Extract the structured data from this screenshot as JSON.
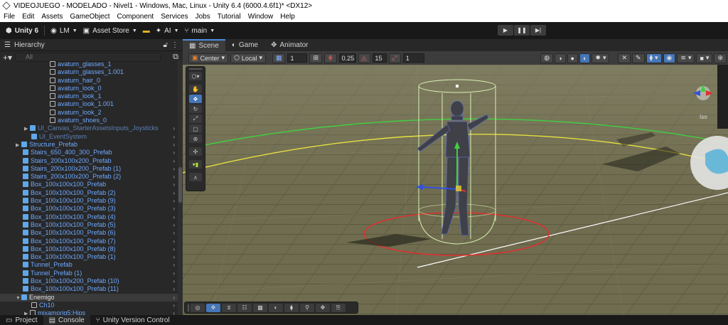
{
  "window": {
    "title": "VIDEOJUEGO - MODELADO - Nivel1 - Windows, Mac, Linux - Unity 6.4 (6000.4.6f1)* <DX12>"
  },
  "menu": [
    "File",
    "Edit",
    "Assets",
    "GameObject",
    "Component",
    "Services",
    "Jobs",
    "Tutorial",
    "Window",
    "Help"
  ],
  "toolbar": {
    "unity_label": "Unity 6",
    "account_label": "LM",
    "asset_store_label": "Asset Store",
    "ai_label": "AI",
    "branch_label": "main"
  },
  "hierarchy": {
    "tab_label": "Hierarchy",
    "search_placeholder": "All",
    "items": [
      {
        "label": "avaturn_glasses_1",
        "icon": "mesh-icon"
      },
      {
        "label": "avaturn_glasses_1.001",
        "icon": "mesh-icon"
      },
      {
        "label": "avaturn_hair_0",
        "icon": "mesh-icon"
      },
      {
        "label": "avaturn_look_0",
        "icon": "mesh-icon"
      },
      {
        "label": "avaturn_look_1",
        "icon": "mesh-icon"
      },
      {
        "label": "avaturn_look_1.001",
        "icon": "mesh-icon"
      },
      {
        "label": "avaturn_look_2",
        "icon": "mesh-icon"
      },
      {
        "label": "avaturn_shoes_0",
        "icon": "mesh-icon"
      },
      {
        "label": "UI_Canvas_StarterAssetsInputs_Joysticks",
        "icon": "prefab-icon"
      },
      {
        "label": "UI_EventSystem",
        "icon": "prefab-icon"
      },
      {
        "label": "Structure_Prefab",
        "icon": "prefab-icon"
      },
      {
        "label": "Stairs_650_400_300_Prefab",
        "icon": "prefab-icon"
      },
      {
        "label": "Stairs_200x100x200_Prefab",
        "icon": "prefab-icon"
      },
      {
        "label": "Stairs_200x100x200_Prefab (1)",
        "icon": "prefab-icon"
      },
      {
        "label": "Stairs_200x100x200_Prefab (2)",
        "icon": "prefab-icon"
      },
      {
        "label": "Box_100x100x100_Prefab",
        "icon": "prefab-icon"
      },
      {
        "label": "Box_100x100x100_Prefab (2)",
        "icon": "prefab-icon"
      },
      {
        "label": "Box_100x100x100_Prefab (9)",
        "icon": "prefab-icon"
      },
      {
        "label": "Box_100x100x100_Prefab (3)",
        "icon": "prefab-icon"
      },
      {
        "label": "Box_100x100x100_Prefab (4)",
        "icon": "prefab-icon"
      },
      {
        "label": "Box_100x100x100_Prefab (5)",
        "icon": "prefab-icon"
      },
      {
        "label": "Box_100x100x100_Prefab (6)",
        "icon": "prefab-icon"
      },
      {
        "label": "Box_100x100x100_Prefab (7)",
        "icon": "prefab-icon"
      },
      {
        "label": "Box_100x100x100_Prefab (8)",
        "icon": "prefab-icon"
      },
      {
        "label": "Box_100x100x100_Prefab (1)",
        "icon": "prefab-icon"
      },
      {
        "label": "Tunnel_Prefab",
        "icon": "prefab-icon"
      },
      {
        "label": "Tunnel_Prefab (1)",
        "icon": "prefab-icon"
      },
      {
        "label": "Box_100x100x200_Prefab (10)",
        "icon": "prefab-icon"
      },
      {
        "label": "Box_100x100x100_Prefab (11)",
        "icon": "prefab-icon"
      },
      {
        "label": "Enemigo",
        "icon": "prefab-icon"
      },
      {
        "label": "Ch10",
        "icon": "mesh-icon"
      },
      {
        "label": "mixamorig5:Hips",
        "icon": "mesh-icon"
      }
    ]
  },
  "scene": {
    "tabs": [
      "Scene",
      "Game",
      "Animator"
    ],
    "pivot_label": "Center",
    "space_label": "Local",
    "grid_value": "1",
    "snap_value": "0.25",
    "rotate_snap_value": "15",
    "scale_snap_value": "1",
    "gizmo_label": "Iso"
  },
  "bottom_tabs": [
    "Project",
    "Console",
    "Unity Version Control"
  ],
  "colors": {
    "accent": "#4c8de0",
    "prefab": "#6ea8ff",
    "ground": "#6b6a50"
  }
}
